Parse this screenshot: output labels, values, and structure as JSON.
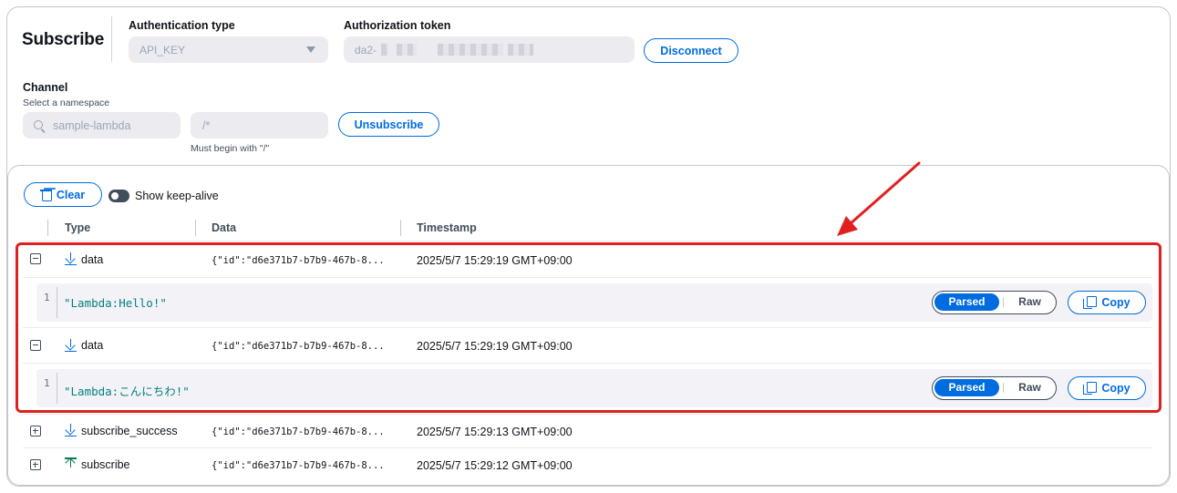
{
  "header": {
    "title": "Subscribe",
    "auth_type_label": "Authentication type",
    "auth_type_value": "API_KEY",
    "auth_token_label": "Authorization token",
    "auth_token_value": "da2-",
    "disconnect_label": "Disconnect"
  },
  "channel": {
    "label": "Channel",
    "description": "Select a namespace",
    "namespace_placeholder": "sample-lambda",
    "path_placeholder": "/*",
    "path_hint": "Must begin with \"/\"",
    "unsubscribe_label": "Unsubscribe"
  },
  "events": {
    "clear_label": "Clear",
    "keepalive_label": "Show keep-alive",
    "keepalive_on": false,
    "columns": [
      "Type",
      "Data",
      "Timestamp"
    ],
    "rows": [
      {
        "type": "data",
        "direction": "down",
        "expanded": true,
        "data": "{\"id\":\"d6e371b7-b7b9-467b-8...",
        "timestamp": "2025/5/7 15:29:19 GMT+09:00",
        "line": "1",
        "payload": "\"Lambda:Hello!\"",
        "parsed_label": "Parsed",
        "raw_label": "Raw",
        "copy_label": "Copy"
      },
      {
        "type": "data",
        "direction": "down",
        "expanded": true,
        "data": "{\"id\":\"d6e371b7-b7b9-467b-8...",
        "timestamp": "2025/5/7 15:29:19 GMT+09:00",
        "line": "1",
        "payload": "\"Lambda:こんにちわ!\"",
        "parsed_label": "Parsed",
        "raw_label": "Raw",
        "copy_label": "Copy"
      },
      {
        "type": "subscribe_success",
        "direction": "down",
        "expanded": false,
        "data": "{\"id\":\"d6e371b7-b7b9-467b-8...",
        "timestamp": "2025/5/7 15:29:13 GMT+09:00"
      },
      {
        "type": "subscribe",
        "direction": "up",
        "expanded": false,
        "data": "{\"id\":\"d6e371b7-b7b9-467b-8...",
        "timestamp": "2025/5/7 15:29:12 GMT+09:00"
      }
    ]
  },
  "colors": {
    "accent": "#006ce0",
    "highlight": "#e02020",
    "download_icon": "#006ce0",
    "upload_icon": "#037f51",
    "code_text": "#037f80"
  }
}
